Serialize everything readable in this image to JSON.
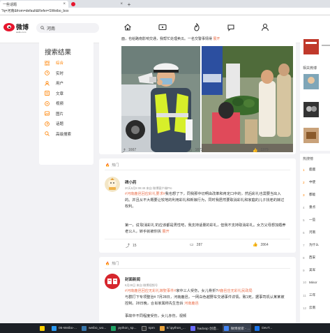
{
  "browser": {
    "tabs": [
      {
        "title": "一些话题",
        "active": true
      },
      {
        "title": "",
        "active": false
      }
    ],
    "new_tab": "+",
    "address": "?q=河南&from=default&Refer=SWeibo_box"
  },
  "header": {
    "logo_text": "微博",
    "logo_sub": "weibo.com",
    "search_query": "河南",
    "nav_icons": [
      "home-icon",
      "video-icon",
      "hot-icon",
      "message-icon",
      "profile-icon"
    ]
  },
  "sidebar": {
    "title": "搜索结果",
    "items": [
      {
        "label": "综合",
        "icon": "grid-icon",
        "active": true
      },
      {
        "label": "实时",
        "icon": "clock-icon",
        "active": false
      },
      {
        "label": "用户",
        "icon": "user-icon",
        "active": false
      },
      {
        "label": "文章",
        "icon": "article-icon",
        "active": false
      },
      {
        "label": "视频",
        "icon": "play-icon",
        "active": false
      },
      {
        "label": "图片",
        "icon": "image-icon",
        "active": false
      },
      {
        "label": "话题",
        "icon": "topic-icon",
        "active": false
      },
      {
        "label": "高级搜索",
        "icon": "advanced-search-icon",
        "active": false
      }
    ]
  },
  "post1": {
    "text": "面，也给路南影响交通，我帮忙处理卖瓜。一名交警事情得",
    "more": "展开",
    "actions": {
      "repost": "1667",
      "comment": "1673",
      "like": "1379"
    }
  },
  "post2": {
    "hot_label": "热门",
    "name": "碑小药",
    "meta": "20天6月8 08:48 来自 微博客户端Pro",
    "para1_prefix": "#",
    "para1_tag": "河南鹿邑回应彩礼要求#",
    "para1_rest": "我也想了下，同我那中切啊由改革和肯定口中的，然后彩礼也需要当出入的。并且从不大概要让较地的利用彩礼和新娘行为，同时我居然要取消彩礼和家庭的儿子找老的嫁过权利。",
    "para2": "第一，说‘取消彩礼’的应该都是男性吧，我支持适量的彩礼，但我不支持取消彩礼。女方父母想加婚养老公人，转手就被你拆",
    "para2_more": "展开",
    "actions": {
      "repost": "15",
      "comment": "287",
      "like": "2864"
    }
  },
  "post3": {
    "hot_label": "热门",
    "name": "封面新闻",
    "meta": "6月28日 来自 微博视频号",
    "para1_tag": "#河南鹿邑回应无彩礼嫁娶事件#",
    "para1_rest": "家中三人受伤，女儿骨折?",
    "para1_tag2": "#鹿邑应无彩礼民政局",
    "para2": "与群打下专项整治# 7月28日，河南鹿邑，一网白色越野车交通事件详情，致1死，据事司机认某某被控制。28日晚，合肖家属称先生告诉",
    "para2_more": "河南鹿邑",
    "para3": "事故中不同程度受伤，女儿赤伤，视频"
  },
  "right_panel": {
    "related_title": "相关微博",
    "hot_title": "热搜榜",
    "hot_rows": [
      {
        "rank": "1",
        "text": "鹿鹿"
      },
      {
        "rank": "2",
        "text": "中使"
      },
      {
        "rank": "3",
        "text": "都能"
      },
      {
        "rank": "4",
        "text": "重点"
      },
      {
        "rank": "5",
        "text": "一些"
      },
      {
        "rank": "6",
        "text": "河南"
      },
      {
        "rank": "7",
        "text": "为什么"
      },
      {
        "rank": "8",
        "text": "西安"
      },
      {
        "rank": "9",
        "text": "美军"
      },
      {
        "rank": "10",
        "text": "Minor"
      },
      {
        "rank": "11",
        "text": "三年"
      },
      {
        "rank": "12",
        "text": "云南"
      }
    ]
  },
  "taskbar": {
    "items": [
      {
        "label": "",
        "color": "#ffd000"
      },
      {
        "label": "05-Weibo-...",
        "color": "#2b9af3"
      },
      {
        "label": "weibo_wo...",
        "color": "#3776ab"
      },
      {
        "label": "python_sp...",
        "color": "#21a366"
      },
      {
        "label": "npm",
        "color": "#333333"
      },
      {
        "label": "E:\\python_...",
        "color": "#e8a33d"
      },
      {
        "label": "hadoop 创造...",
        "color": "#6c6cff"
      },
      {
        "label": "微博搜索 - ...",
        "color": "#4285f4",
        "active": true
      },
      {
        "label": "DevT...",
        "color": "#1a73e8"
      }
    ]
  }
}
